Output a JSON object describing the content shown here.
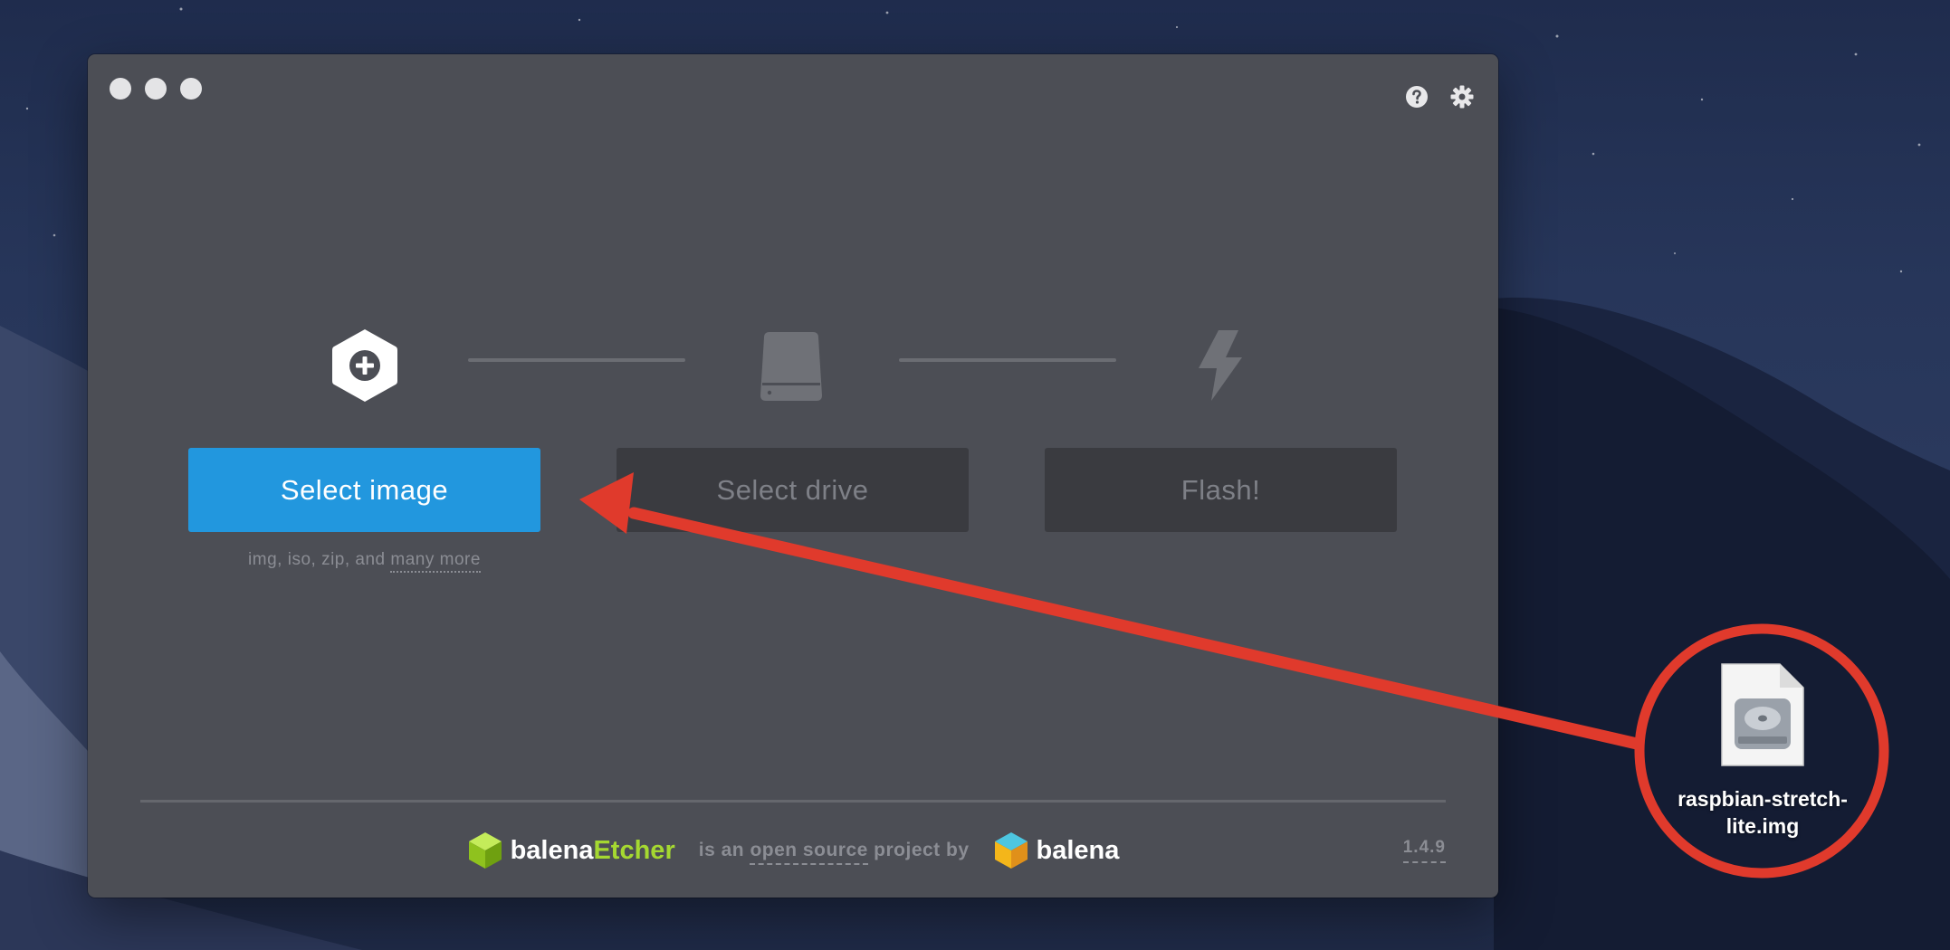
{
  "window": {
    "traffic_lights": [
      "close",
      "minimize",
      "maximize"
    ],
    "top_icons": [
      "help-icon",
      "settings-gear-icon"
    ]
  },
  "steps": [
    {
      "icon": "plus-hexagon-icon",
      "button_label": "Select image",
      "state": "active"
    },
    {
      "icon": "drive-icon",
      "button_label": "Select drive",
      "state": "disabled"
    },
    {
      "icon": "lightning-bolt-icon",
      "button_label": "Flash!",
      "state": "disabled"
    }
  ],
  "hint": {
    "formats": "img, iso, zip, and",
    "more_link": "many more"
  },
  "footer": {
    "brand_prefix": "balena",
    "brand_suffix": "Etcher",
    "tagline_prefix": "is an",
    "tagline_link": "open source",
    "tagline_suffix": "project by",
    "company": "balena",
    "version": "1.4.9"
  },
  "desktop_file": {
    "name": "raspbian-stretch-lite.img",
    "label_line1": "raspbian-stretch-",
    "label_line2": "lite.img",
    "icon": "disk-image-file-icon"
  },
  "colors": {
    "primary": "#2297de",
    "window_bg": "#4c4e55",
    "disabled_button": "#3a3b40",
    "etcher_green": "#a5d831",
    "annotation_red": "#e03a2c"
  }
}
